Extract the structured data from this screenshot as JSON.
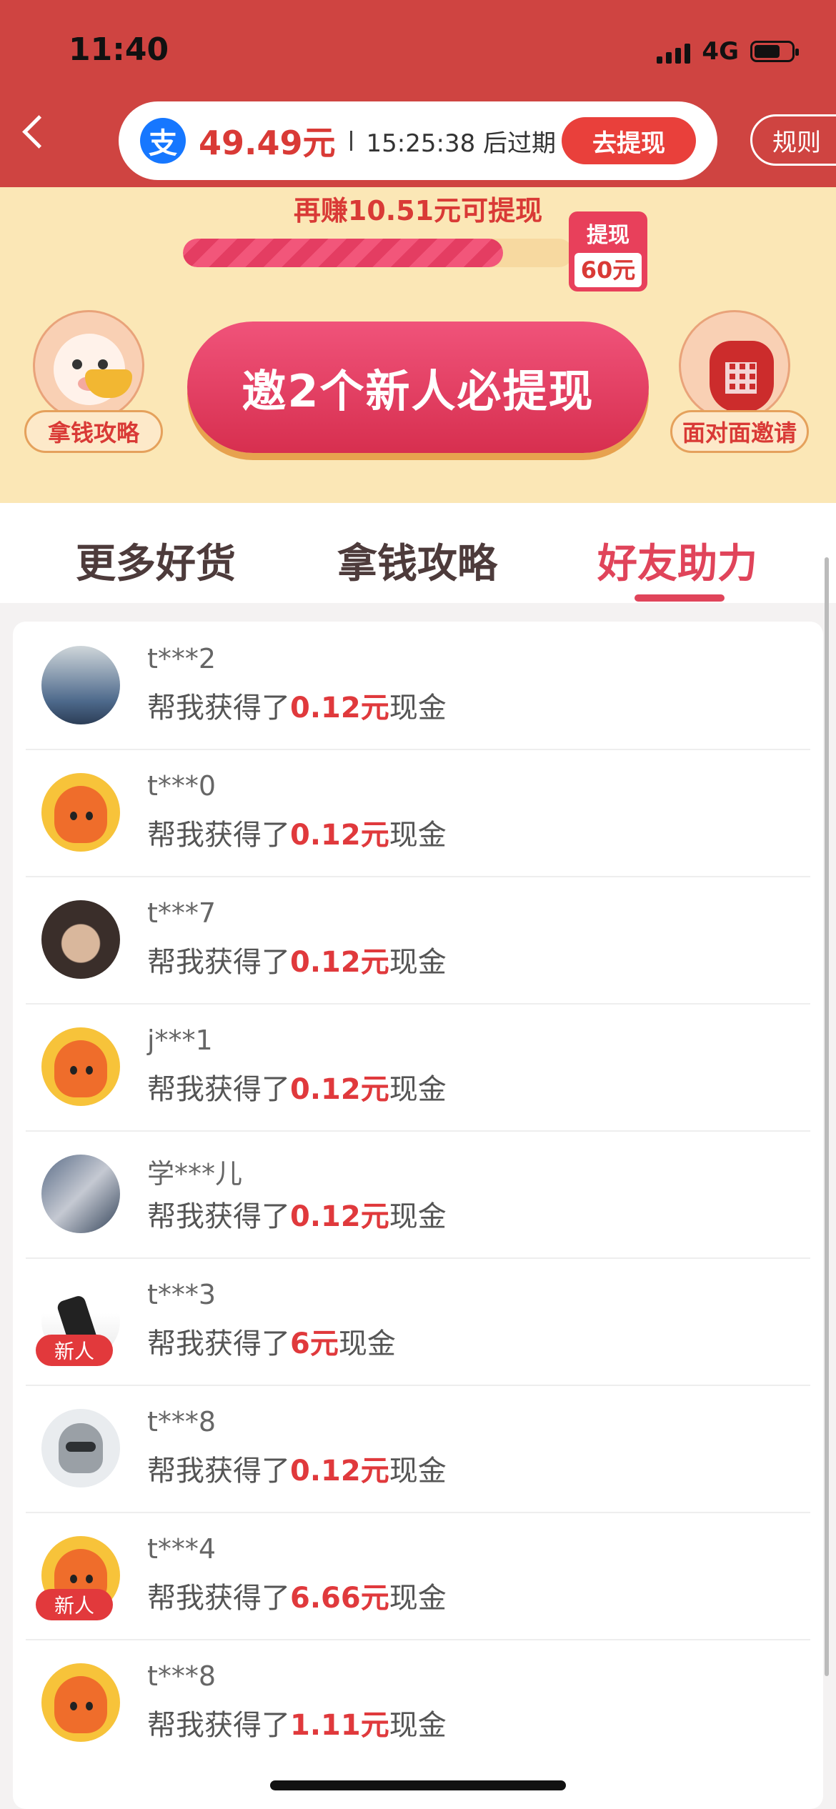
{
  "status_bar": {
    "time": "11:40",
    "network": "4G"
  },
  "header": {
    "alipay_glyph": "支",
    "balance": "49.49元",
    "expire_text": "15:25:38 后过期",
    "withdraw_button": "去提现",
    "rules_button": "规则"
  },
  "promo": {
    "earn_more_text": "再赚10.51元可提现",
    "progress_fraction": 0.82,
    "goal_label": "提现",
    "goal_value": "60元",
    "left_badge": "拿钱攻略",
    "invite_button": "邀2个新人必提现",
    "right_badge": "面对面邀请"
  },
  "tabs": [
    {
      "label": "更多好货",
      "active": false
    },
    {
      "label": "拿钱攻略",
      "active": false
    },
    {
      "label": "好友助力",
      "active": true
    }
  ],
  "helpers": [
    {
      "name": "t***2",
      "prefix": "帮我获得了",
      "amount": "0.12元",
      "suffix": "现金",
      "avatar": "photo",
      "newbie": false
    },
    {
      "name": "t***0",
      "prefix": "帮我获得了",
      "amount": "0.12元",
      "suffix": "现金",
      "avatar": "mascot",
      "newbie": false
    },
    {
      "name": "t***7",
      "prefix": "帮我获得了",
      "amount": "0.12元",
      "suffix": "现金",
      "avatar": "photo",
      "newbie": false
    },
    {
      "name": "j***1",
      "prefix": "帮我获得了",
      "amount": "0.12元",
      "suffix": "现金",
      "avatar": "mascot",
      "newbie": false
    },
    {
      "name": "学***儿",
      "prefix": "帮我获得了",
      "amount": "0.12元",
      "suffix": "现金",
      "avatar": "photo",
      "newbie": false
    },
    {
      "name": "t***3",
      "prefix": "帮我获得了",
      "amount": "6元",
      "suffix": "现金",
      "avatar": "photo",
      "newbie": true
    },
    {
      "name": "t***8",
      "prefix": "帮我获得了",
      "amount": "0.12元",
      "suffix": "现金",
      "avatar": "knight",
      "newbie": false
    },
    {
      "name": "t***4",
      "prefix": "帮我获得了",
      "amount": "6.66元",
      "suffix": "现金",
      "avatar": "mascot",
      "newbie": true
    },
    {
      "name": "t***8",
      "prefix": "帮我获得了",
      "amount": "1.11元",
      "suffix": "现金",
      "avatar": "mascot",
      "newbie": false
    }
  ],
  "newbie_label": "新人"
}
